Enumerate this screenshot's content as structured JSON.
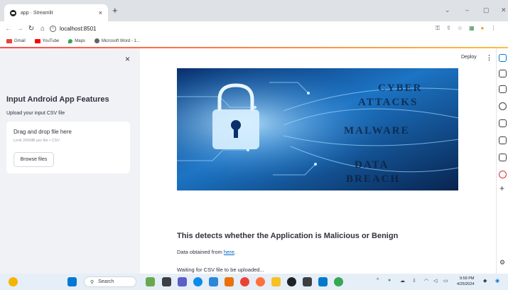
{
  "browser": {
    "tab_title": "app · Streamlit",
    "tab_close": "×",
    "new_tab": "+",
    "url": "localhost:8501",
    "bookmarks": [
      {
        "label": "Gmail",
        "color": "#ea4335"
      },
      {
        "label": "YouTube",
        "color": "#ff0000"
      },
      {
        "label": "Maps",
        "color": "#34a853"
      },
      {
        "label": "Microsoft Word - 1...",
        "color": "#5f6368"
      }
    ]
  },
  "sidebar": {
    "close": "×",
    "title": "Input Android App Features",
    "upload_label": "Upload your input CSV file",
    "dropzone_title": "Drag and drop file here",
    "dropzone_limit": "Limit 200MB per file • CSV",
    "browse_button": "Browse files"
  },
  "toolbar": {
    "deploy": "Deploy",
    "menu": "⋮"
  },
  "hero_image": {
    "words": [
      "CYBER",
      "ATTACKS",
      "MALWARE",
      "DATA",
      "BREACH"
    ]
  },
  "main": {
    "title": "This detects whether the Application is Malicious or Benign",
    "source_prefix": "Data obtained from ",
    "source_link": "here",
    "source_suffix": ".",
    "status": "Waiting for CSV file to be uploaded..."
  },
  "taskbar": {
    "search": "Search",
    "time": "9:59 PM",
    "date": "4/25/2024"
  },
  "colors": {
    "accent_red": "#ff4b4b",
    "accent_yellow": "#ffbd45",
    "link": "#0068c9",
    "sidebar_bg": "#f0f2f6",
    "text": "#31333f"
  }
}
